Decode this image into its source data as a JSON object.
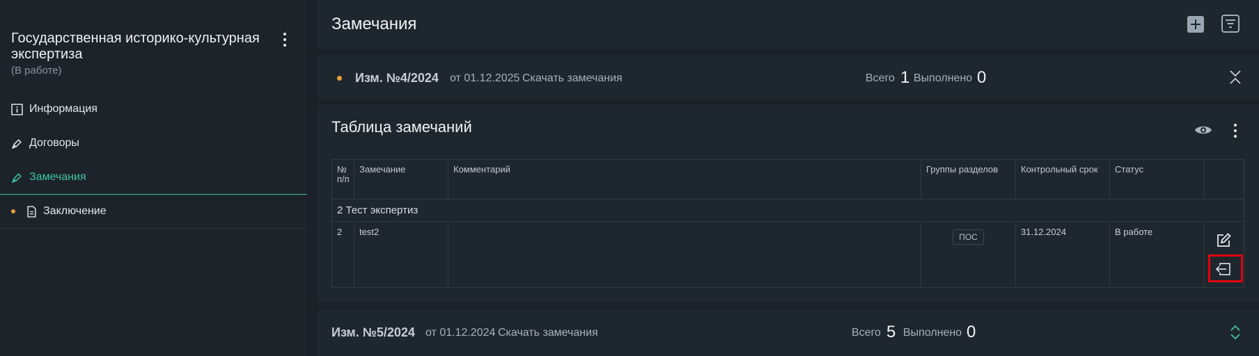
{
  "sidebar": {
    "project_title": "Государственная историко-культурная экспертиза",
    "project_status": "(В работе)",
    "items": [
      {
        "label": "Информация",
        "icon": "info-icon"
      },
      {
        "label": "Договоры",
        "icon": "pen-icon"
      },
      {
        "label": "Замечания",
        "icon": "pen-icon",
        "active": true
      },
      {
        "label": "Заключение",
        "icon": "document-icon",
        "status_dot": "#e8a33b"
      }
    ]
  },
  "header": {
    "title": "Замечания",
    "add_icon": "plus-icon",
    "filter_icon": "filter-icon"
  },
  "revisions": [
    {
      "title": "Изм. №4/2024",
      "date": "от 01.12.2025",
      "download": "Скачать замечания",
      "total_label": "Всего",
      "total": "1",
      "done_label": "Выполнено",
      "done": "0",
      "expanded": true
    },
    {
      "title": "Изм. №5/2024",
      "date": "от 01.12.2024",
      "download": "Скачать замечания",
      "total_label": "Всего",
      "total": "5",
      "done_label": "Выполнено",
      "done": "0",
      "expanded": false
    }
  ],
  "table": {
    "title": "Таблица замечаний",
    "columns": [
      "№ п/п",
      "Замечание",
      "Комментарий",
      "Группы разделов",
      "Контрольный срок",
      "Статус",
      ""
    ],
    "group": "2 Тест экспертиз",
    "rows": [
      {
        "num": "2",
        "remark": "test2",
        "comment": "",
        "group_tag": "ПОС",
        "deadline": "31.12.2024",
        "status": "В работе"
      }
    ]
  },
  "colors": {
    "accent": "#3fc3a9",
    "status_dot": "#e8a33b",
    "highlight": "#e3000f",
    "background": "#1b2127",
    "panel": "#1f272e"
  }
}
